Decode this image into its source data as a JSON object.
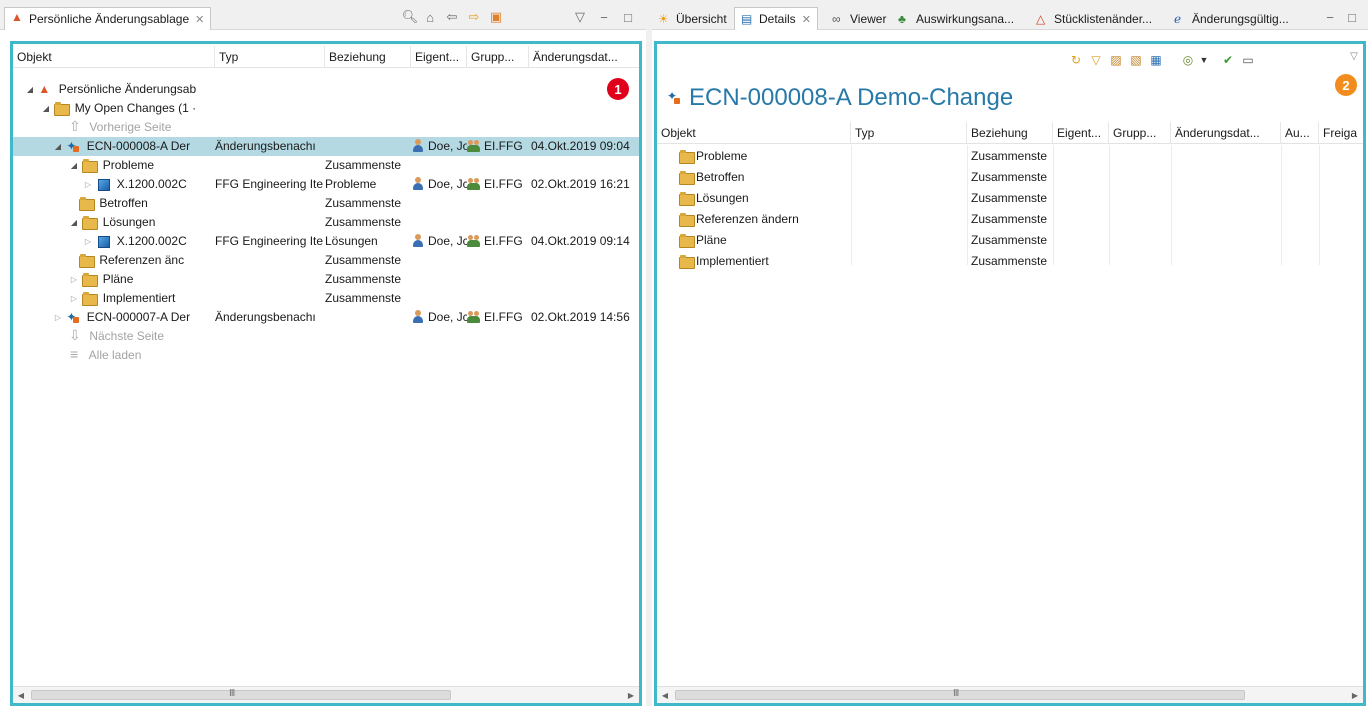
{
  "left": {
    "tab_label": "Persönliche Änderungsablage",
    "close_glyph": "✕",
    "columns": [
      "Objekt",
      "Typ",
      "Beziehung",
      "Eigent...",
      "Grupp...",
      "Änderungsdat..."
    ],
    "badge": "1",
    "rows": [
      {
        "name": "Persönliche Änderungsab",
        "typ": "",
        "bez": "",
        "owner": "",
        "group": "",
        "date": ""
      },
      {
        "name": "My Open Changes (1 ·",
        "typ": "",
        "bez": "",
        "owner": "",
        "group": "",
        "date": ""
      },
      {
        "name": "Vorherige Seite",
        "typ": "",
        "bez": "",
        "owner": "",
        "group": "",
        "date": ""
      },
      {
        "name": "ECN-000008-A Der",
        "typ": "Änderungsbenachı",
        "bez": "",
        "owner": "Doe, Jo",
        "group": "EI.FFG",
        "date": "04.Okt.2019 09:04"
      },
      {
        "name": "Probleme",
        "typ": "",
        "bez": "Zusammenste",
        "owner": "",
        "group": "",
        "date": ""
      },
      {
        "name": "X.1200.002C",
        "typ": "FFG Engineering Ite",
        "bez": "Probleme",
        "owner": "Doe, Jc",
        "group": "EI.FFG",
        "date": "02.Okt.2019 16:21"
      },
      {
        "name": "Betroffen",
        "typ": "",
        "bez": "Zusammenste",
        "owner": "",
        "group": "",
        "date": ""
      },
      {
        "name": "Lösungen",
        "typ": "",
        "bez": "Zusammenste",
        "owner": "",
        "group": "",
        "date": ""
      },
      {
        "name": "X.1200.002C",
        "typ": "FFG Engineering Ite",
        "bez": "Lösungen",
        "owner": "Doe, Jc",
        "group": "EI.FFG",
        "date": "04.Okt.2019 09:14"
      },
      {
        "name": "Referenzen änc",
        "typ": "",
        "bez": "Zusammenste",
        "owner": "",
        "group": "",
        "date": ""
      },
      {
        "name": "Pläne",
        "typ": "",
        "bez": "Zusammenste",
        "owner": "",
        "group": "",
        "date": ""
      },
      {
        "name": "Implementiert",
        "typ": "",
        "bez": "Zusammenste",
        "owner": "",
        "group": "",
        "date": ""
      },
      {
        "name": "ECN-000007-A Der",
        "typ": "Änderungsbenachı",
        "bez": "",
        "owner": "Doe, Jc",
        "group": "EI.FFG",
        "date": "02.Okt.2019 14:56"
      },
      {
        "name": "Nächste Seite",
        "typ": "",
        "bez": "",
        "owner": "",
        "group": "",
        "date": ""
      },
      {
        "name": "Alle laden",
        "typ": "",
        "bez": "",
        "owner": "",
        "group": "",
        "date": ""
      }
    ],
    "scroll_grip": "III"
  },
  "right": {
    "tabs": [
      "Übersicht",
      "Details",
      "Viewer",
      "Auswirkungsana...",
      "Stücklistenänder...",
      "Änderungsgültig..."
    ],
    "title": "ECN-000008-A Demo-Change",
    "badge": "2",
    "columns": [
      "Objekt",
      "Typ",
      "Beziehung",
      "Eigent...",
      "Grupp...",
      "Änderungsdat...",
      "Au...",
      "Freiga"
    ],
    "rows": [
      {
        "name": "Probleme",
        "bez": "Zusammenste"
      },
      {
        "name": "Betroffen",
        "bez": "Zusammenste"
      },
      {
        "name": "Lösungen",
        "bez": "Zusammenste"
      },
      {
        "name": "Referenzen ändern",
        "bez": "Zusammenste"
      },
      {
        "name": "Pläne",
        "bez": "Zusammenste"
      },
      {
        "name": "Implementiert",
        "bez": "Zusammenste"
      }
    ],
    "scroll_grip": "III"
  },
  "colors": {
    "accent": "#3fb8c9",
    "selection": "#b4d9e3",
    "badge_red": "#e0001b",
    "badge_orange": "#f28c1e",
    "title": "#2779a8"
  }
}
